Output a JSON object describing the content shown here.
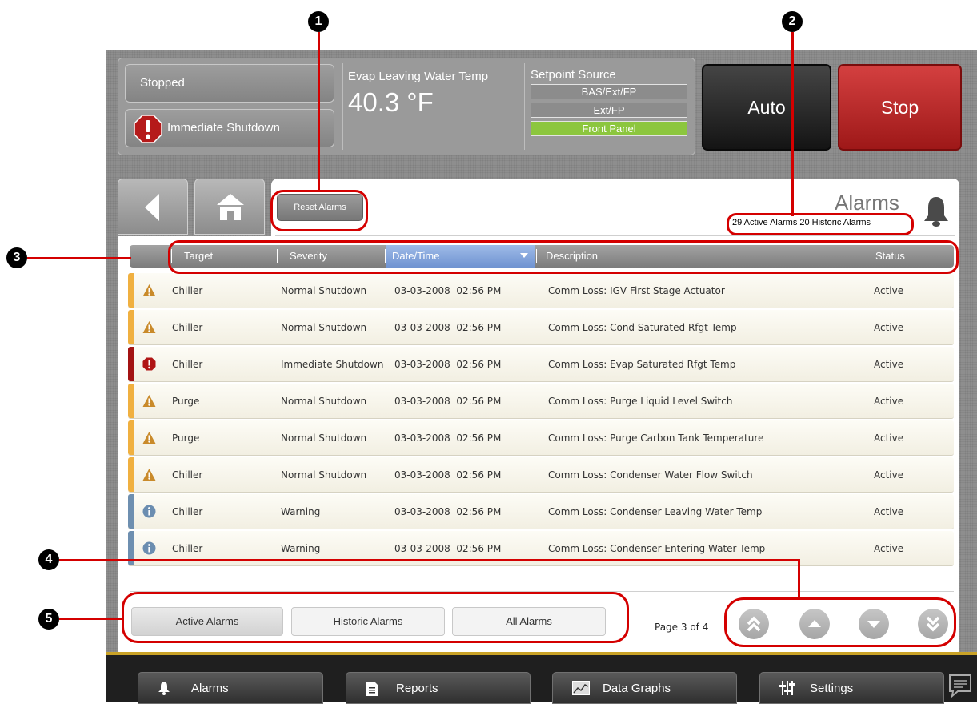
{
  "callouts": [
    "1",
    "2",
    "3",
    "4",
    "5"
  ],
  "status": {
    "operating_mode": "Stopped",
    "shutdown_state": "Immediate Shutdown",
    "evap_label": "Evap Leaving Water Temp",
    "evap_value": "40.3 °F",
    "setpoint_label": "Setpoint Source",
    "setpoint_options": [
      "BAS/Ext/FP",
      "Ext/FP",
      "Front Panel"
    ],
    "setpoint_active": "Front Panel"
  },
  "controls": {
    "auto": "Auto",
    "stop": "Stop"
  },
  "header": {
    "reset_button": "Reset Alarms",
    "title": "Alarms",
    "counts": "29 Active Alarms  20 Historic Alarms"
  },
  "table": {
    "columns": [
      "Target",
      "Severity",
      "Date/Time",
      "Description",
      "Status"
    ],
    "rows": [
      {
        "severity_type": "warning",
        "target": "Chiller",
        "severity": "Normal Shutdown",
        "datetime": "03-03-2008  02:56 PM",
        "description": "Comm Loss: IGV First Stage Actuator",
        "status": "Active"
      },
      {
        "severity_type": "warning",
        "target": "Chiller",
        "severity": "Normal Shutdown",
        "datetime": "03-03-2008  02:56 PM",
        "description": "Comm Loss: Cond Saturated Rfgt Temp",
        "status": "Active"
      },
      {
        "severity_type": "critical",
        "target": "Chiller",
        "severity": "Immediate Shutdown",
        "datetime": "03-03-2008  02:56 PM",
        "description": "Comm Loss: Evap Saturated Rfgt Temp",
        "status": "Active"
      },
      {
        "severity_type": "warning",
        "target": "Purge",
        "severity": "Normal Shutdown",
        "datetime": "03-03-2008  02:56 PM",
        "description": "Comm Loss: Purge Liquid Level Switch",
        "status": "Active"
      },
      {
        "severity_type": "warning",
        "target": "Purge",
        "severity": "Normal Shutdown",
        "datetime": "03-03-2008  02:56 PM",
        "description": "Comm Loss: Purge Carbon Tank Temperature",
        "status": "Active"
      },
      {
        "severity_type": "warning",
        "target": "Chiller",
        "severity": "Normal Shutdown",
        "datetime": "03-03-2008  02:56 PM",
        "description": "Comm Loss: Condenser Water Flow Switch",
        "status": "Active"
      },
      {
        "severity_type": "info",
        "target": "Chiller",
        "severity": "Warning",
        "datetime": "03-03-2008  02:56 PM",
        "description": "Comm Loss: Condenser Leaving Water Temp",
        "status": "Active"
      },
      {
        "severity_type": "info",
        "target": "Chiller",
        "severity": "Warning",
        "datetime": "03-03-2008  02:56 PM",
        "description": "Comm Loss: Condenser Entering Water Temp",
        "status": "Active"
      }
    ]
  },
  "filters": [
    "Active Alarms",
    "Historic Alarms",
    "All Alarms"
  ],
  "selected_filter": "Active Alarms",
  "pagination": {
    "label": "Page 3 of 4"
  },
  "footer": [
    "Alarms",
    "Reports",
    "Data Graphs",
    "Settings"
  ],
  "colors": {
    "warning": "#f0b040",
    "critical": "#a31313",
    "info": "#6e8fb0",
    "active_setpoint": "#8cc63e",
    "stop": "#c02828"
  },
  "icons": {
    "critical": "exclamation-octagon-icon",
    "warning": "warning-triangle-icon",
    "info": "info-circle-icon",
    "nav_back": "back-arrow-icon",
    "nav_home": "home-icon",
    "alarms": "bell-icon",
    "reports": "report-icon",
    "graphs": "chart-icon",
    "settings": "sliders-icon",
    "chat": "chat-bubble-icon"
  }
}
